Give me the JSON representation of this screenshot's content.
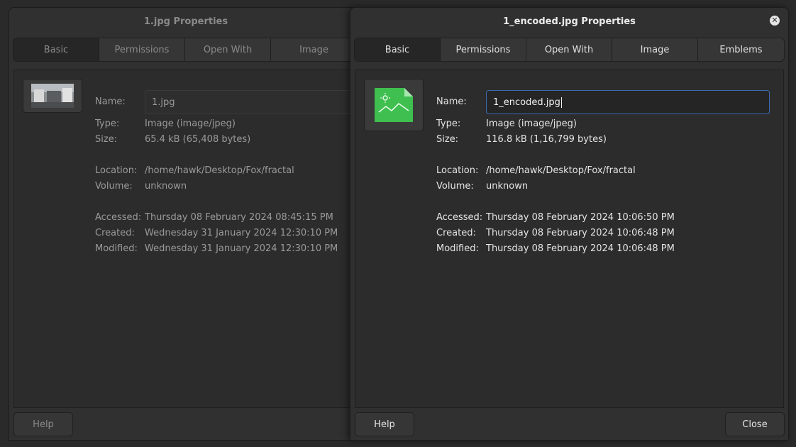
{
  "back_window": {
    "title": "1.jpg Properties",
    "tabs": [
      "Basic",
      "Permissions",
      "Open With",
      "Image"
    ],
    "fields": {
      "name_label": "Name:",
      "name_value": "1.jpg",
      "type_label": "Type:",
      "type_value": "Image (image/jpeg)",
      "size_label": "Size:",
      "size_value": "65.4 kB (65,408 bytes)",
      "location_label": "Location:",
      "location_value": "/home/hawk/Desktop/Fox/fractal",
      "volume_label": "Volume:",
      "volume_value": "unknown",
      "accessed_label": "Accessed:",
      "accessed_value": "Thursday 08 February 2024 08:45:15 PM",
      "created_label": "Created:",
      "created_value": "Wednesday 31 January 2024 12:30:10 PM",
      "modified_label": "Modified:",
      "modified_value": "Wednesday 31 January 2024 12:30:10 PM"
    },
    "help_label": "Help"
  },
  "front_window": {
    "title": "1_encoded.jpg Properties",
    "close_glyph": "✕",
    "tabs": [
      "Basic",
      "Permissions",
      "Open With",
      "Image",
      "Emblems"
    ],
    "fields": {
      "name_label": "Name:",
      "name_value": "1_encoded.jpg",
      "type_label": "Type:",
      "type_value": "Image (image/jpeg)",
      "size_label": "Size:",
      "size_value": "116.8 kB (1,16,799 bytes)",
      "location_label": "Location:",
      "location_value": "/home/hawk/Desktop/Fox/fractal",
      "volume_label": "Volume:",
      "volume_value": "unknown",
      "accessed_label": "Accessed:",
      "accessed_value": "Thursday 08 February 2024 10:06:50 PM",
      "created_label": "Created:",
      "created_value": "Thursday 08 February 2024 10:06:48 PM",
      "modified_label": "Modified:",
      "modified_value": "Thursday 08 February 2024 10:06:48 PM"
    },
    "help_label": "Help",
    "close_label": "Close"
  },
  "colors": {
    "accent_focus": "#3d6bb3",
    "image_icon_green": "#3fbf4f"
  },
  "icons": {
    "back_thumbnail": "photo-thumbnail",
    "front_icon": "image-file-icon"
  }
}
